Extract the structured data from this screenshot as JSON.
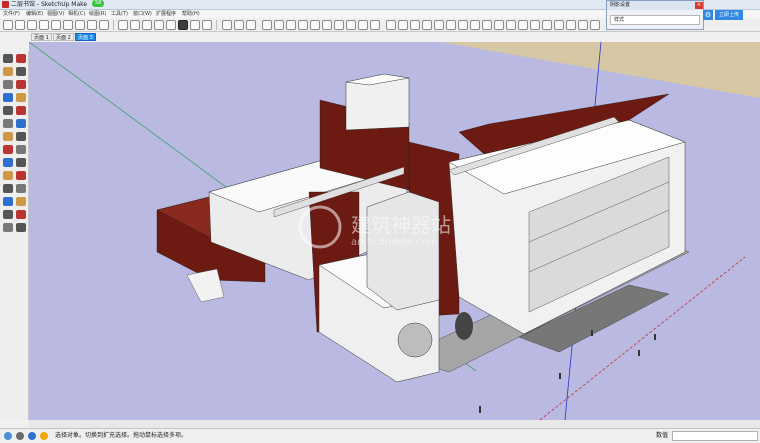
{
  "window": {
    "title": "二层书馆 - SketchUp Make",
    "badge": "58"
  },
  "menu": [
    "文件(F)",
    "编辑(E)",
    "视图(V)",
    "相机(C)",
    "绘图(R)",
    "工具(T)",
    "窗口(W)",
    "扩展程序",
    "帮助(H)"
  ],
  "scenes": [
    "页面 1",
    "页面 2",
    "页面 3"
  ],
  "active_scene": 2,
  "dialog": {
    "title": "阴影设置",
    "row_label": "样式",
    "close": "×"
  },
  "login_button": "立即上传",
  "watermark": {
    "main": "建筑神器站",
    "sub": "archcomeon.com"
  },
  "status": {
    "text": "选择对象。切换到扩充选择。拖动鼠标选择多项。",
    "measure_label": "数值"
  },
  "colors": {
    "sky": "#b9b9e1",
    "ground": "#d6c8a4",
    "brick": "#6d1a12",
    "accent": "#1e88e5"
  }
}
